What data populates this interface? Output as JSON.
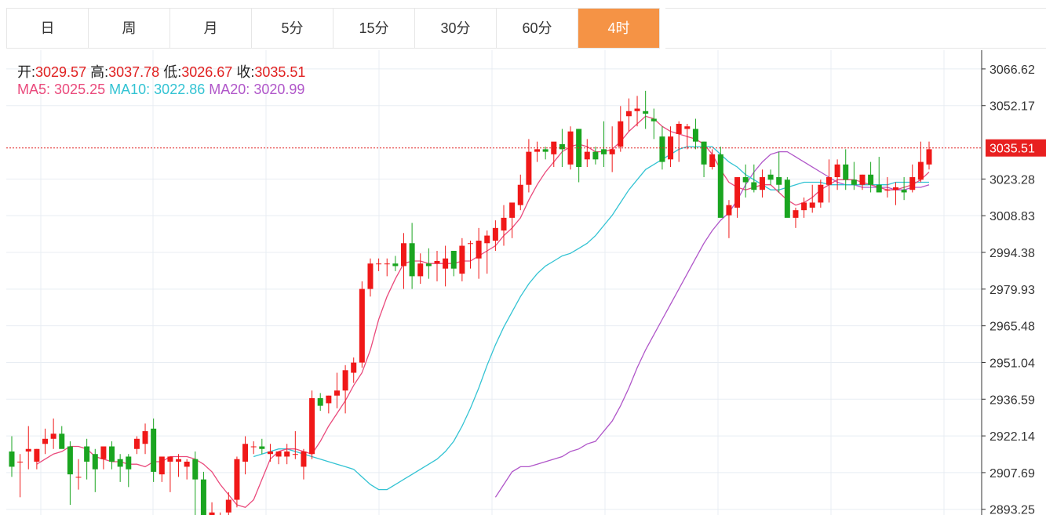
{
  "tabs": [
    {
      "label": "日",
      "active": false
    },
    {
      "label": "周",
      "active": false
    },
    {
      "label": "月",
      "active": false
    },
    {
      "label": "5分",
      "active": false
    },
    {
      "label": "15分",
      "active": false
    },
    {
      "label": "30分",
      "active": false
    },
    {
      "label": "60分",
      "active": false
    },
    {
      "label": "4时",
      "active": true
    }
  ],
  "ohlc_info": {
    "open_label": "开:",
    "open": "3029.57",
    "high_label": "高:",
    "high": "3037.78",
    "low_label": "低:",
    "low": "3026.67",
    "close_label": "收:",
    "close": "3035.51"
  },
  "ma_info": {
    "ma5_label": "MA5:",
    "ma5": "3025.25",
    "ma10_label": "MA10:",
    "ma10": "3022.86",
    "ma20_label": "MA20:",
    "ma20": "3020.99"
  },
  "colors": {
    "up": "#f01818",
    "down": "#1aa520",
    "ma5": "#ea4a7c",
    "ma10": "#33c3d3",
    "ma20": "#b056c9",
    "grid": "#e8edf3",
    "active_tab": "#f59345"
  },
  "chart_data": {
    "type": "candlestick",
    "y_ticks": [
      "3066.62",
      "3052.17",
      "3023.28",
      "3008.83",
      "2994.38",
      "2979.93",
      "2965.48",
      "2951.04",
      "2936.59",
      "2922.14",
      "2907.69",
      "2893.25"
    ],
    "ylim": [
      2891,
      3074
    ],
    "grid": true,
    "current_price": "3035.51",
    "candles": [
      [
        2916,
        2922,
        2906,
        2910
      ],
      [
        2912,
        2915,
        2898,
        2912
      ],
      [
        2916,
        2926,
        2909,
        2917
      ],
      [
        2912,
        2917,
        2909,
        2917
      ],
      [
        2919,
        2925,
        2915,
        2921
      ],
      [
        2921,
        2929,
        2917,
        2923
      ],
      [
        2923,
        2926,
        2920,
        2917
      ],
      [
        2918,
        2920,
        2895,
        2907
      ],
      [
        2906,
        2913,
        2901,
        2906
      ],
      [
        2918,
        2921,
        2905,
        2912
      ],
      [
        2915,
        2917,
        2900,
        2909
      ],
      [
        2913,
        2916,
        2909,
        2918
      ],
      [
        2918,
        2920,
        2909,
        2912
      ],
      [
        2913,
        2915,
        2904,
        2910
      ],
      [
        2914,
        2915,
        2902,
        2909
      ],
      [
        2917,
        2922,
        2915,
        2921
      ],
      [
        2919,
        2927,
        2915,
        2924
      ],
      [
        2925,
        2929,
        2904,
        2908
      ],
      [
        2907,
        2912,
        2904,
        2914
      ],
      [
        2912,
        2914,
        2900,
        2914
      ],
      [
        2912,
        2915,
        2906,
        2913
      ],
      [
        2910,
        2913,
        2905,
        2912
      ],
      [
        2913,
        2916,
        2890,
        2905
      ],
      [
        2905,
        2908,
        2888,
        2891
      ],
      [
        2885,
        2896,
        2884,
        2892
      ],
      [
        2890,
        2892,
        2889,
        2891
      ],
      [
        2892,
        2900,
        2888,
        2897
      ],
      [
        2897,
        2914,
        2894,
        2913
      ],
      [
        2912,
        2922,
        2907,
        2919
      ],
      [
        2918,
        2920,
        2915,
        2918
      ],
      [
        2918,
        2921,
        2915,
        2917
      ],
      [
        2915,
        2919,
        2912,
        2916
      ],
      [
        2914,
        2916,
        2911,
        2916
      ],
      [
        2914,
        2919,
        2911,
        2916
      ],
      [
        2915,
        2924,
        2913,
        2915
      ],
      [
        2910,
        2917,
        2905,
        2916
      ],
      [
        2915,
        2940,
        2913,
        2937
      ],
      [
        2937,
        2939,
        2932,
        2934
      ],
      [
        2935,
        2938,
        2931,
        2938
      ],
      [
        2938,
        2947,
        2933,
        2940
      ],
      [
        2940,
        2950,
        2931,
        2948
      ],
      [
        2947,
        2953,
        2943,
        2951
      ],
      [
        2951,
        2983,
        2949,
        2980
      ],
      [
        2980,
        2992,
        2977,
        2990
      ],
      [
        2990,
        2992,
        2987,
        2990
      ],
      [
        2990,
        2992,
        2985,
        2990
      ],
      [
        2990,
        2993,
        2987,
        2989
      ],
      [
        2989,
        3002,
        2980,
        2998
      ],
      [
        2998,
        3006,
        2980,
        2985
      ],
      [
        2985,
        2994,
        2982,
        2990
      ],
      [
        2990,
        2996,
        2984,
        2989
      ],
      [
        2990,
        2995,
        2983,
        2991
      ],
      [
        2988,
        2997,
        2981,
        2992
      ],
      [
        2995,
        2994,
        2985,
        2988
      ],
      [
        2986,
        3000,
        2983,
        2997
      ],
      [
        2998,
        2999,
        2988,
        2998
      ],
      [
        2992,
        3004,
        2984,
        2999
      ],
      [
        2998,
        3003,
        2986,
        3001
      ],
      [
        2999,
        3007,
        2995,
        3004
      ],
      [
        3003,
        3013,
        2997,
        3008
      ],
      [
        3008,
        3012,
        3000,
        3014
      ],
      [
        3013,
        3025,
        3011,
        3021
      ],
      [
        3021,
        3039,
        3018,
        3034
      ],
      [
        3034,
        3038,
        3030,
        3035
      ],
      [
        3035,
        3036,
        3031,
        3034
      ],
      [
        3033,
        3035,
        3028,
        3038
      ],
      [
        3037,
        3043,
        3028,
        3035
      ],
      [
        3029,
        3044,
        3027,
        3042
      ],
      [
        3043,
        3043,
        3022,
        3028
      ],
      [
        3031,
        3039,
        3028,
        3034
      ],
      [
        3034,
        3036,
        3029,
        3031
      ],
      [
        3035,
        3046,
        3028,
        3033
      ],
      [
        3033,
        3044,
        3026,
        3035
      ],
      [
        3036,
        3052,
        3034,
        3046
      ],
      [
        3048,
        3055,
        3042,
        3050
      ],
      [
        3050,
        3056,
        3044,
        3051
      ],
      [
        3050,
        3058,
        3043,
        3049
      ],
      [
        3047,
        3051,
        3039,
        3046
      ],
      [
        3040,
        3044,
        3027,
        3030
      ],
      [
        3031,
        3044,
        3028,
        3040
      ],
      [
        3041,
        3046,
        3030,
        3045
      ],
      [
        3043,
        3045,
        3035,
        3044
      ],
      [
        3043,
        3047,
        3035,
        3038
      ],
      [
        3038,
        3038,
        3024,
        3029
      ],
      [
        3028,
        3035,
        3027,
        3033
      ],
      [
        3033,
        3036,
        3010,
        3008
      ],
      [
        3009,
        3015,
        3000,
        3013
      ],
      [
        3012,
        3024,
        3008,
        3024
      ],
      [
        3024,
        3029,
        3016,
        3022
      ],
      [
        3022,
        3029,
        3018,
        3019
      ],
      [
        3019,
        3027,
        3016,
        3024
      ],
      [
        3025,
        3027,
        3021,
        3023
      ],
      [
        3024,
        3034,
        3018,
        3021
      ],
      [
        3023,
        3024,
        3013,
        3008
      ],
      [
        3008,
        3012,
        3004,
        3011
      ],
      [
        3011,
        3016,
        3008,
        3014
      ],
      [
        3012,
        3021,
        3010,
        3014
      ],
      [
        3014,
        3023,
        3012,
        3021
      ],
      [
        3021,
        3031,
        3014,
        3024
      ],
      [
        3024,
        3031,
        3019,
        3029
      ],
      [
        3029,
        3035,
        3019,
        3023
      ],
      [
        3023,
        3030,
        3019,
        3021
      ],
      [
        3021,
        3025,
        3019,
        3025
      ],
      [
        3025,
        3030,
        3018,
        3021
      ],
      [
        3021,
        3032,
        3019,
        3018
      ],
      [
        3019,
        3024,
        3016,
        3019
      ],
      [
        3019,
        3022,
        3013,
        3020
      ],
      [
        3019,
        3024,
        3015,
        3018
      ],
      [
        3019,
        3029,
        3018,
        3024
      ],
      [
        3023,
        3038,
        3022,
        3030
      ],
      [
        3029,
        3038,
        3027,
        3035
      ]
    ],
    "ma5_line": [
      2911,
      2913,
      2915,
      2916,
      2918,
      2918,
      2917,
      2914,
      2913,
      2912,
      2912,
      2911,
      2911,
      2910,
      2912,
      2912,
      2914,
      2914,
      2914,
      2913,
      2911,
      2908,
      2903,
      2899,
      2895,
      2894,
      2897,
      2905,
      2913,
      2916,
      2917,
      2917,
      2916,
      2915,
      2920,
      2926,
      2931,
      2936,
      2942,
      2947,
      2956,
      2968,
      2977,
      2984,
      2990,
      2991,
      2991,
      2990,
      2990,
      2990,
      2990,
      2991,
      2991,
      2993,
      2995,
      2997,
      3001,
      3004,
      3008,
      3015,
      3021,
      3026,
      3030,
      3034,
      3036,
      3037,
      3036,
      3034,
      3034,
      3035,
      3038,
      3042,
      3045,
      3048,
      3047,
      3044,
      3042,
      3041,
      3040,
      3039,
      3037,
      3033,
      3027,
      3022,
      3020,
      3019,
      3020,
      3021,
      3021,
      3018,
      3015,
      3013,
      3014,
      3016,
      3019,
      3021,
      3023,
      3023,
      3023,
      3022,
      3021,
      3020,
      3019,
      3019,
      3020,
      3021,
      3023,
      3026
    ],
    "ma10_line": [
      2914,
      2915,
      2916,
      2917,
      2917,
      2916,
      2915,
      2914,
      2913,
      2912,
      2911,
      2910,
      2909,
      2906,
      2903,
      2901,
      2901,
      2903,
      2905,
      2907,
      2909,
      2911,
      2913,
      2916,
      2920,
      2926,
      2933,
      2941,
      2950,
      2958,
      2965,
      2971,
      2977,
      2982,
      2986,
      2989,
      2991,
      2993,
      2994,
      2996,
      2998,
      3001,
      3005,
      3009,
      3014,
      3019,
      3023,
      3027,
      3029,
      3031,
      3033,
      3035,
      3036,
      3036,
      3036,
      3036,
      3033,
      3030,
      3028,
      3025,
      3023,
      3021,
      3019,
      3019,
      3020,
      3021,
      3022,
      3022,
      3022,
      3021,
      3021,
      3021,
      3021,
      3021,
      3021,
      3021,
      3021,
      3022,
      3022,
      3022,
      3022,
      3022
    ],
    "ma20_line": [
      2898,
      2903,
      2908,
      2910,
      2910,
      2911,
      2912,
      2913,
      2914,
      2916,
      2917,
      2919,
      2920,
      2924,
      2928,
      2934,
      2941,
      2949,
      2956,
      2962,
      2968,
      2974,
      2980,
      2986,
      2992,
      2998,
      3003,
      3007,
      3010,
      3015,
      3021,
      3026,
      3030,
      3033,
      3034,
      3034,
      3032,
      3030,
      3028,
      3026,
      3024,
      3022,
      3021,
      3021,
      3020,
      3020,
      3020,
      3020,
      3019,
      3019,
      3020,
      3020,
      3021
    ]
  }
}
